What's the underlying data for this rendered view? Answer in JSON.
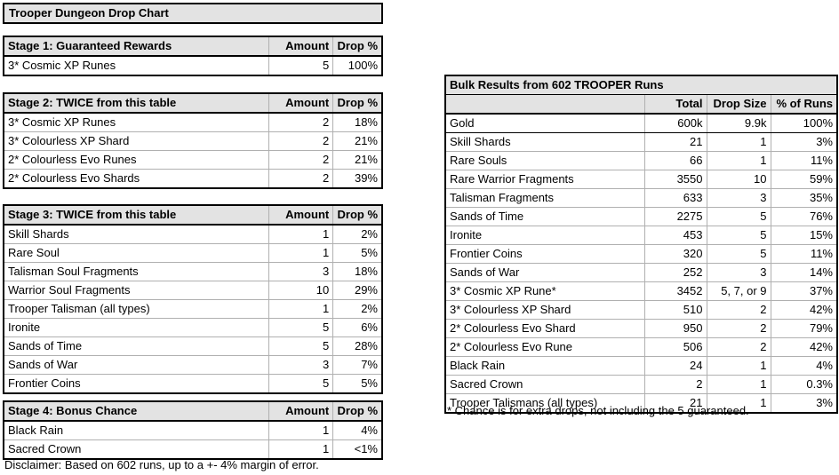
{
  "banner": {
    "title": "Trooper Dungeon Drop Chart"
  },
  "left_tables": [
    {
      "id": "stage1",
      "header": {
        "name": "Stage 1: Guaranteed Rewards",
        "amount": "Amount",
        "drop": "Drop %"
      },
      "rows": [
        {
          "name": "3* Cosmic XP Runes",
          "amount": "5",
          "drop": "100%"
        }
      ]
    },
    {
      "id": "stage2",
      "header": {
        "name": "Stage 2: TWICE from this table",
        "amount": "Amount",
        "drop": "Drop %"
      },
      "rows": [
        {
          "name": "3* Cosmic XP Runes",
          "amount": "2",
          "drop": "18%"
        },
        {
          "name": "3* Colourless XP Shard",
          "amount": "2",
          "drop": "21%"
        },
        {
          "name": "2* Colourless Evo Runes",
          "amount": "2",
          "drop": "21%"
        },
        {
          "name": "2* Colourless Evo Shards",
          "amount": "2",
          "drop": "39%"
        }
      ]
    },
    {
      "id": "stage3",
      "header": {
        "name": "Stage 3: TWICE from this table",
        "amount": "Amount",
        "drop": "Drop %"
      },
      "rows": [
        {
          "name": "Skill Shards",
          "amount": "1",
          "drop": "2%"
        },
        {
          "name": "Rare Soul",
          "amount": "1",
          "drop": "5%"
        },
        {
          "name": "Talisman Soul Fragments",
          "amount": "3",
          "drop": "18%"
        },
        {
          "name": "Warrior Soul Fragments",
          "amount": "10",
          "drop": "29%"
        },
        {
          "name": "Trooper Talisman (all types)",
          "amount": "1",
          "drop": "2%"
        },
        {
          "name": "Ironite",
          "amount": "5",
          "drop": "6%"
        },
        {
          "name": "Sands of Time",
          "amount": "5",
          "drop": "28%"
        },
        {
          "name": "Sands of War",
          "amount": "3",
          "drop": "7%"
        },
        {
          "name": "Frontier Coins",
          "amount": "5",
          "drop": "5%"
        }
      ]
    },
    {
      "id": "stage4",
      "header": {
        "name": "Stage 4: Bonus Chance",
        "amount": "Amount",
        "drop": "Drop %"
      },
      "rows": [
        {
          "name": "Black Rain",
          "amount": "1",
          "drop": "4%"
        },
        {
          "name": "Sacred Crown",
          "amount": "1",
          "drop": "<1%"
        }
      ]
    }
  ],
  "disclaimer": "Disclaimer: Based on 602 runs, up to a +- 4% margin of error.",
  "bulk": {
    "title": "Bulk Results from 602 TROOPER Runs",
    "columns": {
      "name": "",
      "total": "Total",
      "drop_size": "Drop Size",
      "pct": "% of Runs"
    },
    "rows": [
      {
        "name": "Gold",
        "total": "600k",
        "drop_size": "9.9k",
        "pct": "100%"
      },
      {
        "name": "Skill Shards",
        "total": "21",
        "drop_size": "1",
        "pct": "3%"
      },
      {
        "name": "Rare Souls",
        "total": "66",
        "drop_size": "1",
        "pct": "11%"
      },
      {
        "name": "Rare Warrior Fragments",
        "total": "3550",
        "drop_size": "10",
        "pct": "59%"
      },
      {
        "name": "Talisman Fragments",
        "total": "633",
        "drop_size": "3",
        "pct": "35%"
      },
      {
        "name": "Sands of Time",
        "total": "2275",
        "drop_size": "5",
        "pct": "76%"
      },
      {
        "name": "Ironite",
        "total": "453",
        "drop_size": "5",
        "pct": "15%"
      },
      {
        "name": "Frontier Coins",
        "total": "320",
        "drop_size": "5",
        "pct": "11%"
      },
      {
        "name": "Sands of War",
        "total": "252",
        "drop_size": "3",
        "pct": "14%"
      },
      {
        "name": "3* Cosmic XP Rune*",
        "total": "3452",
        "drop_size": "5, 7, or 9",
        "pct": "37%"
      },
      {
        "name": "3* Colourless XP Shard",
        "total": "510",
        "drop_size": "2",
        "pct": "42%"
      },
      {
        "name": "2* Colourless Evo Shard",
        "total": "950",
        "drop_size": "2",
        "pct": "79%"
      },
      {
        "name": "2* Colourless Evo Rune",
        "total": "506",
        "drop_size": "2",
        "pct": "42%"
      },
      {
        "name": "Black Rain",
        "total": "24",
        "drop_size": "1",
        "pct": "4%"
      },
      {
        "name": "Sacred Crown",
        "total": "2",
        "drop_size": "1",
        "pct": "0.3%"
      },
      {
        "name": "Trooper Talismans (all types)",
        "total": "21",
        "drop_size": "1",
        "pct": "3%"
      }
    ],
    "footnote": "* Chance is for extra drops, not including the 5 guaranteed."
  },
  "colors": {
    "header_bg": "#e3e3e3",
    "border_outer": "#000000",
    "border_inner": "#b0b0b0",
    "text": "#000000",
    "page_bg": "#ffffff"
  }
}
